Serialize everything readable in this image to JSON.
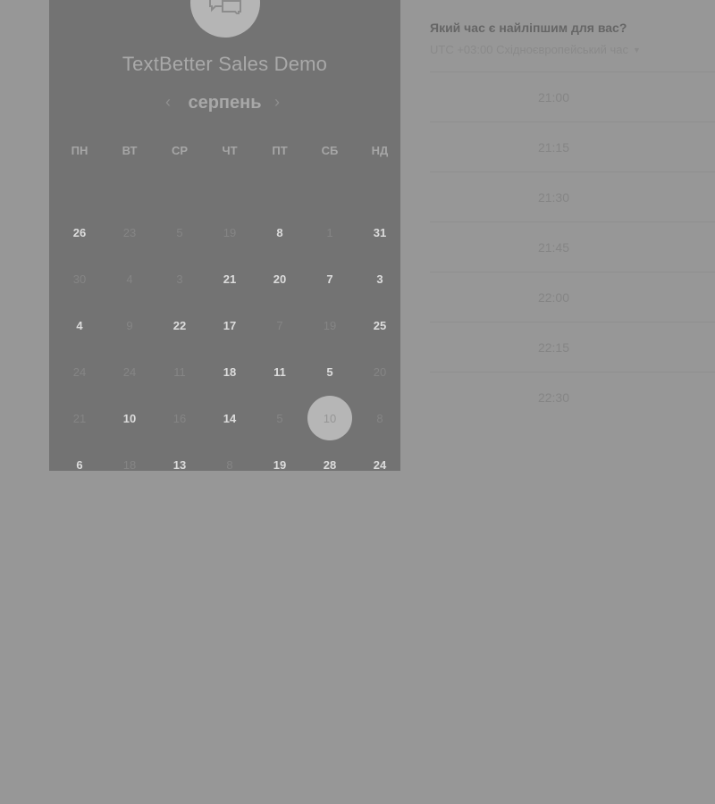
{
  "event": {
    "title": "TextBetter Sales Demo",
    "logo_icon": "chat-bubbles-icon"
  },
  "calendar": {
    "month": "серпень",
    "prev_icon": "chevron-left-icon",
    "next_icon": "chevron-right-icon",
    "weekdays": [
      "ПН",
      "ВТ",
      "СР",
      "ЧТ",
      "ПТ",
      "СБ",
      "НД"
    ],
    "weeks": [
      [
        {
          "d": "26",
          "on": true
        },
        {
          "d": "23",
          "on": false
        },
        {
          "d": "5",
          "on": false
        },
        {
          "d": "19",
          "on": false
        },
        {
          "d": "8",
          "on": true
        },
        {
          "d": "1",
          "on": false
        },
        {
          "d": "31",
          "on": true
        }
      ],
      [
        {
          "d": "30",
          "on": false
        },
        {
          "d": "4",
          "on": false
        },
        {
          "d": "3",
          "on": false
        },
        {
          "d": "21",
          "on": true
        },
        {
          "d": "20",
          "on": true
        },
        {
          "d": "7",
          "on": true
        },
        {
          "d": "3",
          "on": true
        }
      ],
      [
        {
          "d": "4",
          "on": true
        },
        {
          "d": "9",
          "on": false
        },
        {
          "d": "22",
          "on": true
        },
        {
          "d": "17",
          "on": true
        },
        {
          "d": "7",
          "on": false
        },
        {
          "d": "19",
          "on": false
        },
        {
          "d": "25",
          "on": true
        }
      ],
      [
        {
          "d": "24",
          "on": false
        },
        {
          "d": "24",
          "on": false
        },
        {
          "d": "11",
          "on": false
        },
        {
          "d": "18",
          "on": true
        },
        {
          "d": "11",
          "on": true
        },
        {
          "d": "5",
          "on": true
        },
        {
          "d": "20",
          "on": false
        }
      ],
      [
        {
          "d": "21",
          "on": false
        },
        {
          "d": "10",
          "on": true
        },
        {
          "d": "16",
          "on": false
        },
        {
          "d": "14",
          "on": true
        },
        {
          "d": "5",
          "on": false
        },
        {
          "d": "10",
          "on": true,
          "selected": true
        },
        {
          "d": "8",
          "on": false
        }
      ],
      [
        {
          "d": "6",
          "on": true
        },
        {
          "d": "18",
          "on": false
        },
        {
          "d": "13",
          "on": true
        },
        {
          "d": "8",
          "on": false
        },
        {
          "d": "19",
          "on": true
        },
        {
          "d": "28",
          "on": true
        },
        {
          "d": "24",
          "on": true
        }
      ]
    ]
  },
  "times": {
    "question": "Який час є найліпшим для вас?",
    "timezone": "UTC +03:00 Східноєвропейський час",
    "timezone_icon": "caret-down-icon",
    "slots": [
      "21:00",
      "21:15",
      "21:30",
      "21:45",
      "22:00",
      "22:15",
      "22:30"
    ]
  }
}
